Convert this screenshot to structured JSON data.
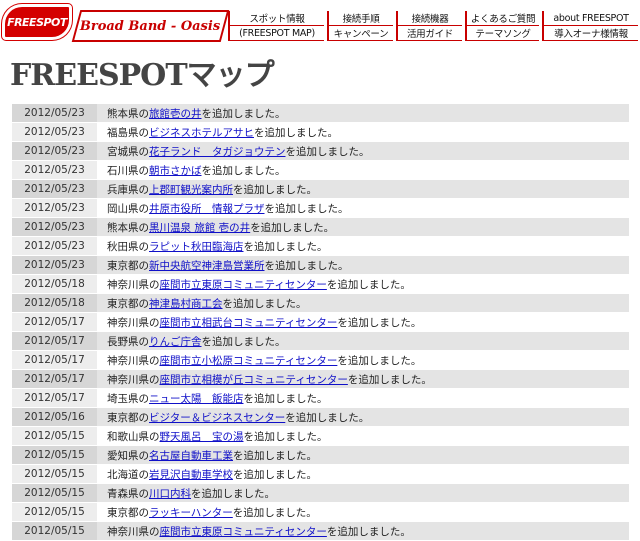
{
  "header": {
    "logo_text": "FREESPOT",
    "brand": "Broad Band - Oasis",
    "nav": [
      {
        "label": "スポット情報"
      },
      {
        "label": "接続手順"
      },
      {
        "label": "接続機器"
      },
      {
        "label": "よくあるご質問"
      },
      {
        "label": "about FREESPOT"
      },
      {
        "label": "(FREESPOT MAP)"
      },
      {
        "label": "キャンペーン"
      },
      {
        "label": "活用ガイド"
      },
      {
        "label": "テーマソング"
      },
      {
        "label": "導入オーナ様情報"
      }
    ]
  },
  "page_title": "FREESPOTマップ",
  "updates": [
    {
      "date": "2012/05/23",
      "prefix": "熊本県の",
      "link": "旅館壱の井",
      "suffix": "を追加しました。"
    },
    {
      "date": "2012/05/23",
      "prefix": "福島県の",
      "link": "ビジネスホテルアサヒ",
      "suffix": "を追加しました。"
    },
    {
      "date": "2012/05/23",
      "prefix": "宮城県の",
      "link": "花子ランド　タガジョウテン",
      "suffix": "を追加しました。"
    },
    {
      "date": "2012/05/23",
      "prefix": "石川県の",
      "link": "朝市さかば",
      "suffix": "を追加しました。"
    },
    {
      "date": "2012/05/23",
      "prefix": "兵庫県の",
      "link": "上郡町観光案内所",
      "suffix": "を追加しました。"
    },
    {
      "date": "2012/05/23",
      "prefix": "岡山県の",
      "link": "井原市役所　情報プラザ",
      "suffix": "を追加しました。"
    },
    {
      "date": "2012/05/23",
      "prefix": "熊本県の",
      "link": "黒川温泉 旅館 壱の井",
      "suffix": "を追加しました。"
    },
    {
      "date": "2012/05/23",
      "prefix": "秋田県の",
      "link": "ラピット秋田臨海店",
      "suffix": "を追加しました。"
    },
    {
      "date": "2012/05/23",
      "prefix": "東京都の",
      "link": "新中央航空神津島営業所",
      "suffix": "を追加しました。"
    },
    {
      "date": "2012/05/18",
      "prefix": "神奈川県の",
      "link": "座間市立東原コミュニティセンター",
      "suffix": "を追加しました。"
    },
    {
      "date": "2012/05/18",
      "prefix": "東京都の",
      "link": "神津島村商工会",
      "suffix": "を追加しました。"
    },
    {
      "date": "2012/05/17",
      "prefix": "神奈川県の",
      "link": "座間市立相武台コミュニティセンター",
      "suffix": "を追加しました。"
    },
    {
      "date": "2012/05/17",
      "prefix": "長野県の",
      "link": "りんご庁舎",
      "suffix": "を追加しました。"
    },
    {
      "date": "2012/05/17",
      "prefix": "神奈川県の",
      "link": "座間市立小松原コミュニティセンター",
      "suffix": "を追加しました。"
    },
    {
      "date": "2012/05/17",
      "prefix": "神奈川県の",
      "link": "座間市立相模が丘コミュニティセンター",
      "suffix": "を追加しました。"
    },
    {
      "date": "2012/05/17",
      "prefix": "埼玉県の",
      "link": "ニュー太陽　飯能店",
      "suffix": "を追加しました。"
    },
    {
      "date": "2012/05/16",
      "prefix": "東京都の",
      "link": "ビジター＆ビジネスセンター",
      "suffix": "を追加しました。"
    },
    {
      "date": "2012/05/15",
      "prefix": "和歌山県の",
      "link": "野天風呂　宝の湯",
      "suffix": "を追加しました。"
    },
    {
      "date": "2012/05/15",
      "prefix": "愛知県の",
      "link": "名古屋自動車工業",
      "suffix": "を追加しました。"
    },
    {
      "date": "2012/05/15",
      "prefix": "北海道の",
      "link": "岩見沢自動車学校",
      "suffix": "を追加しました。"
    },
    {
      "date": "2012/05/15",
      "prefix": "青森県の",
      "link": "川口内科",
      "suffix": "を追加しました。"
    },
    {
      "date": "2012/05/15",
      "prefix": "東京都の",
      "link": "ラッキーハンター",
      "suffix": "を追加しました。"
    },
    {
      "date": "2012/05/15",
      "prefix": "神奈川県の",
      "link": "座間市立東原コミュニティセンター",
      "suffix": "を追加しました。"
    }
  ]
}
